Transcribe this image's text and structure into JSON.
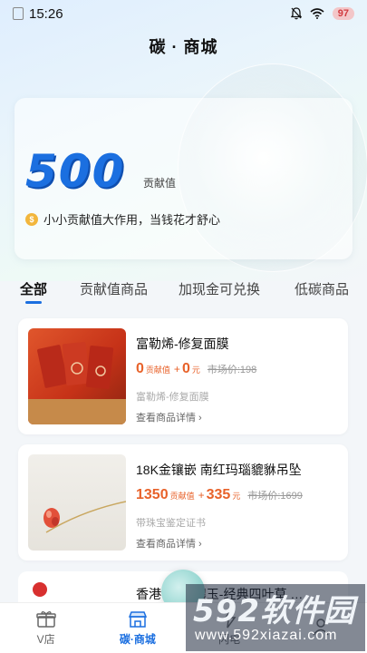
{
  "status": {
    "time": "15:26",
    "battery": "97"
  },
  "header": {
    "title": "碳 · 商城"
  },
  "hero": {
    "value": "500",
    "unit": "贡献值",
    "tip": "小小贡献值大作用，当钱花才舒心",
    "tip_icon": "coin-icon"
  },
  "tabs": [
    {
      "label": "全部",
      "active": true
    },
    {
      "label": "贡献值商品",
      "active": false
    },
    {
      "label": "加现金可兑换",
      "active": false
    },
    {
      "label": "低碳商品",
      "active": false
    }
  ],
  "products": [
    {
      "name": "富勒烯-修复面膜",
      "points": "0",
      "points_unit": "贡献值",
      "plus": "+",
      "cash": "0",
      "cash_unit": "元",
      "market": "市场价:198",
      "subtitle": "富勒烯-修复面膜",
      "link": "查看商品详情 ›"
    },
    {
      "name": "18K金镶嵌 南红玛瑙貔貅吊坠",
      "points": "1350",
      "points_unit": "贡献值",
      "plus": "+",
      "cash": "335",
      "cash_unit": "元",
      "market": "市场价:1699",
      "subtitle": "带珠宝鉴定证书",
      "link": "查看商品详情 ›"
    }
  ],
  "product3": {
    "name": "香港 … 银镶玉-经典四叶草 …"
  },
  "nav": [
    {
      "label": "V店",
      "icon": "gift-icon",
      "active": false
    },
    {
      "label": "碳·商城",
      "icon": "shop-icon",
      "active": true
    },
    {
      "label": "闪电",
      "icon": "lightning-icon",
      "active": false
    },
    {
      "label": "",
      "icon": "user-icon",
      "active": false
    }
  ],
  "watermark": {
    "brand": "592软件园",
    "url": "www.592xiazai.com"
  },
  "colors": {
    "accent": "#1b6fe0",
    "price": "#e8622a"
  }
}
